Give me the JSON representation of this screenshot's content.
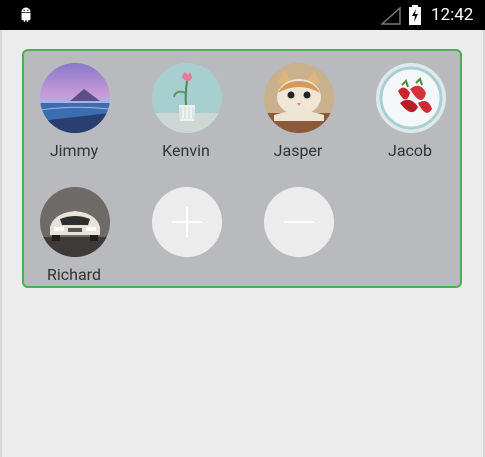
{
  "status_bar": {
    "time": "12:42",
    "icons": [
      "android-notification-icon",
      "signal-icon",
      "battery-charging-icon"
    ]
  },
  "members": [
    {
      "name": "Jimmy",
      "photo": "lake-sunset"
    },
    {
      "name": "Kenvin",
      "photo": "tulip-vase"
    },
    {
      "name": "Jasper",
      "photo": "cat"
    },
    {
      "name": "Jacob",
      "photo": "strawberries"
    },
    {
      "name": "Richard",
      "photo": "sports-car"
    }
  ],
  "actions": {
    "add": "add-member",
    "remove": "remove-member"
  },
  "colors": {
    "panel_border": "#4caf50",
    "panel_bg": "#b8babd",
    "page_bg": "#ececec",
    "action_bg": "#ececec"
  }
}
